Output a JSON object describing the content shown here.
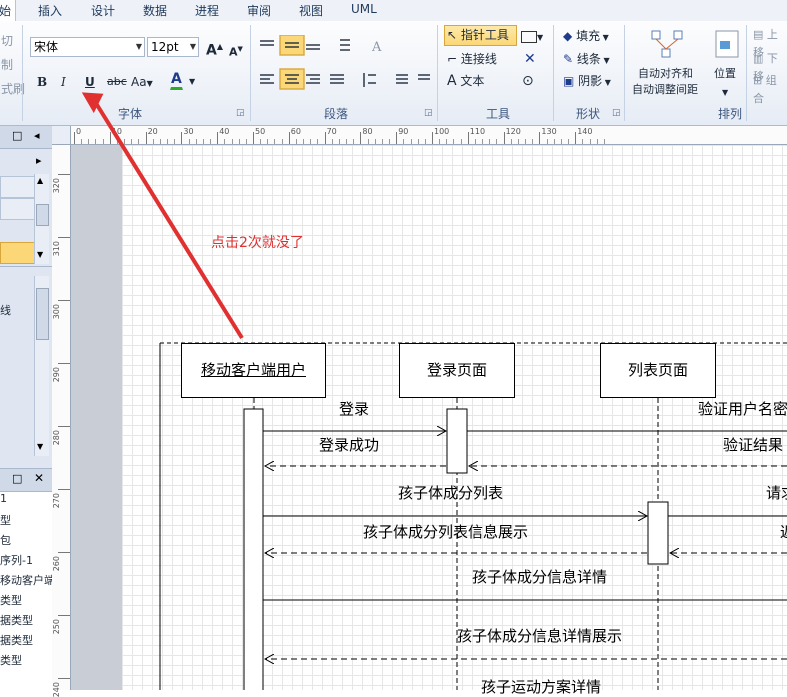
{
  "menu": {
    "tabs": [
      "始",
      "插入",
      "设计",
      "数据",
      "进程",
      "审阅",
      "视图",
      "UML"
    ]
  },
  "ribbon": {
    "clipboard": {
      "cut": "切",
      "copy": "制",
      "format_painter": "式刷"
    },
    "font": {
      "group_label": "字体",
      "font_name": "宋体",
      "font_size": "12pt",
      "bold": "B",
      "italic": "I",
      "underline": "U",
      "strikethrough": "abc",
      "case": "Aa",
      "font_color": "A",
      "grow": "A",
      "shrink": "A"
    },
    "paragraph": {
      "group_label": "段落"
    },
    "tools": {
      "group_label": "工具",
      "pointer": "指针工具",
      "connector": "连接线",
      "text": "文本"
    },
    "shape": {
      "group_label": "形状",
      "fill": "填充",
      "line": "线条",
      "shadow": "阴影"
    },
    "arrange": {
      "group_label": "排列",
      "auto_align": "自动对齐和",
      "auto_spacing": "自动调整间距",
      "position": "位置",
      "bring_forward": "上移",
      "send_backward": "下移",
      "group": "组合"
    },
    "accent_color": "#fbd777"
  },
  "left_panel": {
    "shapes_item": "线",
    "tree_items": [
      "1",
      "型",
      "包",
      "序列-1",
      "移动客户端",
      "类型",
      "据类型",
      "据类型",
      "类型"
    ]
  },
  "ruler": {
    "h_labels": [
      "0",
      "10",
      "20",
      "30",
      "40",
      "50",
      "60",
      "70",
      "80",
      "90",
      "100",
      "110",
      "120",
      "130",
      "140"
    ],
    "v_labels": [
      "320",
      "310",
      "300",
      "290",
      "280",
      "270",
      "260",
      "250",
      "240"
    ]
  },
  "diagram": {
    "lifelines": {
      "user": "移动客户端用户",
      "login_page": "登录页面",
      "list_page": "列表页面"
    },
    "messages": {
      "login": "登录",
      "login_success": "登录成功",
      "validate": "验证用户名密",
      "validate_result": "验证结果",
      "child_list": "孩子体成分列表",
      "request": "请求",
      "child_list_info": "孩子体成分列表信息展示",
      "return": "返",
      "child_detail": "孩子体成分信息详情",
      "child_detail_show": "孩子体成分信息详情展示",
      "child_sport": "孩子运动方案详情"
    },
    "annotation": "点击2次就没了",
    "annotation_color": "#e03030"
  }
}
